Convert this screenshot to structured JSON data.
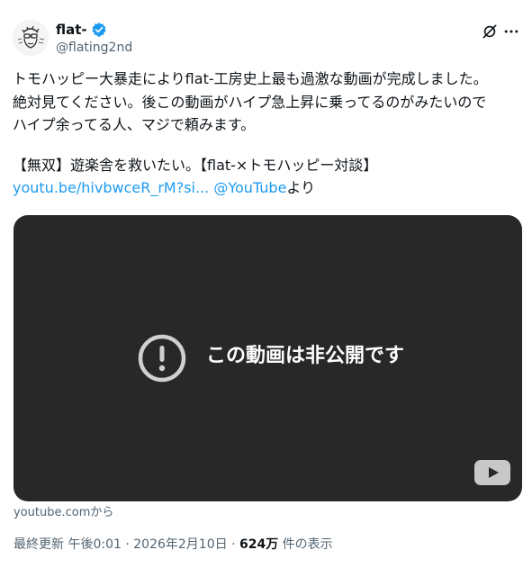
{
  "author": {
    "display_name": "flat-",
    "handle": "@flating2nd",
    "verified": true,
    "verified_color": "#1d9bf0"
  },
  "icons": {
    "avatar": "sketch-avatar-icon",
    "verified": "verified-badge-icon",
    "grok": "grok-icon",
    "more": "more-horizontal-icon",
    "private_video": "exclamation-circle-icon",
    "youtube": "youtube-play-icon"
  },
  "tweet": {
    "lines": [
      "トモハッピー大暴走によりflat-工房史上最も過激な動画が完成しました。",
      "絶対見てください。後この動画がハイプ急上昇に乗ってるのがみたいので",
      "ハイプ余ってる人、マジで頼みます。"
    ],
    "video_title_line": "【無双】遊楽舎を救いたい。【flat-×トモハッピー対談】",
    "link_url_text": "youtu.be/hivbwceR_rM?si...",
    "link_mention": "@YouTube",
    "link_suffix": "より",
    "link_color": "#1d9bf0"
  },
  "card": {
    "private_message": "この動画は非公開です",
    "source_label": "youtube.comから",
    "background_color": "#282828"
  },
  "meta": {
    "prefix": "最終更新",
    "time": "午後0:01",
    "separator": "·",
    "date": "2026年2月10日",
    "views_count": "624万",
    "views_label": "件の表示"
  }
}
